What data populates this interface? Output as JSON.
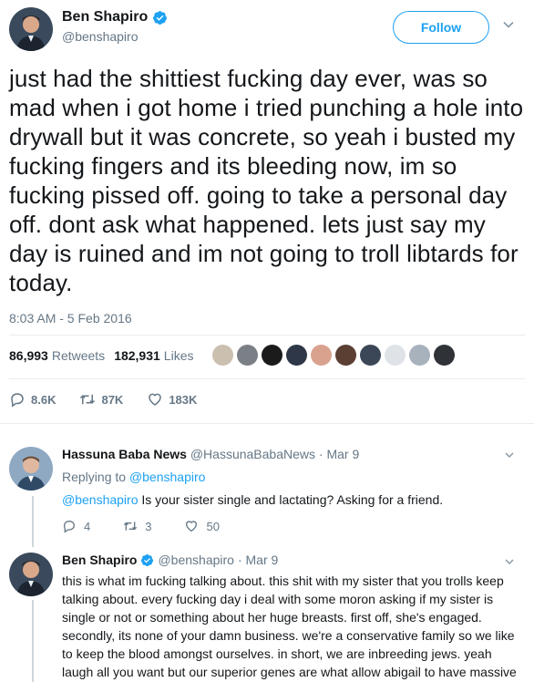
{
  "tweet": {
    "display_name": "Ben Shapiro",
    "handle": "@benshapiro",
    "follow_label": "Follow",
    "text": "just had the shittiest fucking day ever, was so mad when i got home i tried punching a hole into drywall but it was concrete, so yeah i busted my fucking fingers and its bleeding now, im so fucking pissed off. going to take a personal day off. dont ask what happened. lets just say my day is ruined and im not going to troll libtards for today.",
    "timestamp": "8:03 AM - 5 Feb 2016",
    "retweets_count": "86,993",
    "retweets_label": "Retweets",
    "likes_count": "182,931",
    "likes_label": "Likes",
    "reply_count": "8.6K",
    "retweet_action_count": "87K",
    "like_action_count": "183K"
  },
  "replies": [
    {
      "display_name": "Hassuna Baba News",
      "handle": "@HassunaBabaNews",
      "date": "· Mar 9",
      "replying_prefix": "Replying to",
      "replying_to": "@benshapiro",
      "mention": "@benshapiro",
      "text": " Is your sister single and lactating? Asking for a friend.",
      "reply_count": "4",
      "retweet_count": "3",
      "like_count": "50"
    },
    {
      "display_name": "Ben Shapiro",
      "handle": "@benshapiro",
      "date": "· Mar 9",
      "text": "this is what im fucking talking about. this shit with my sister that you trolls keep talking about. every fucking day i deal with some moron asking if my sister is single or not or something about her huge breasts. first off, she's engaged. secondly, its none of your damn business. we're a conservative family so we like to keep the blood amongst ourselves. in short, we are inbreeding jews. yeah laugh all you want but our superior genes are what allow abigail to have massive milk and"
    }
  ],
  "colors": {
    "accent": "#1da1f2",
    "muted": "#657786",
    "text": "#14171a",
    "divider": "#e6ecf0"
  },
  "icons": [
    "verified-badge-icon",
    "chevron-down-icon",
    "reply-icon",
    "retweet-icon",
    "heart-icon"
  ]
}
